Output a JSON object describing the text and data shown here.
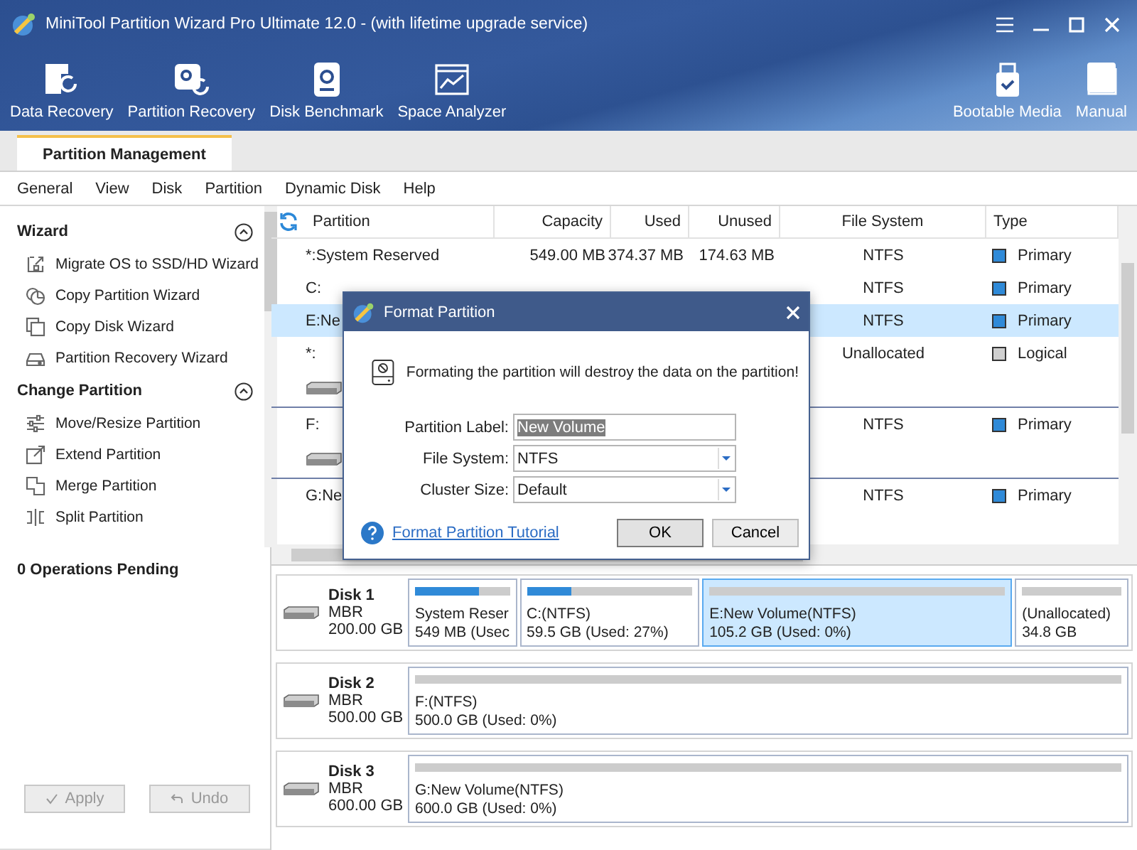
{
  "window": {
    "title": "MiniTool Partition Wizard Pro Ultimate 12.0 - (with lifetime upgrade service)"
  },
  "toolbar": {
    "left": [
      {
        "label": "Data Recovery",
        "kind": "data"
      },
      {
        "label": "Partition Recovery",
        "kind": "partition"
      },
      {
        "label": "Disk Benchmark",
        "kind": "benchmark"
      },
      {
        "label": "Space Analyzer",
        "kind": "analyzer"
      }
    ],
    "right": [
      {
        "label": "Bootable Media",
        "kind": "usb"
      },
      {
        "label": "Manual",
        "kind": "book"
      }
    ]
  },
  "tabs": [
    {
      "label": "Partition Management",
      "selected": true
    }
  ],
  "menu": [
    "General",
    "View",
    "Disk",
    "Partition",
    "Dynamic Disk",
    "Help"
  ],
  "sidebar": {
    "sections": [
      {
        "title": "Wizard",
        "expanded": true,
        "items": [
          {
            "label": "Migrate OS to SSD/HD Wizard",
            "kind": "migrate"
          },
          {
            "label": "Copy Partition Wizard",
            "kind": "copy-partition"
          },
          {
            "label": "Copy Disk Wizard",
            "kind": "copy-disk"
          },
          {
            "label": "Partition Recovery Wizard",
            "kind": "recovery"
          }
        ]
      },
      {
        "title": "Change Partition",
        "expanded": true,
        "items": [
          {
            "label": "Move/Resize Partition",
            "kind": "resize"
          },
          {
            "label": "Extend Partition",
            "kind": "extend"
          },
          {
            "label": "Merge Partition",
            "kind": "merge"
          },
          {
            "label": "Split Partition",
            "kind": "split"
          }
        ]
      }
    ],
    "pending": "0 Operations Pending",
    "buttons": [
      {
        "label": "Apply",
        "kind": "apply",
        "disabled": true
      },
      {
        "label": "Undo",
        "kind": "undo",
        "disabled": true
      }
    ]
  },
  "table": {
    "columns": [
      "Partition",
      "Capacity",
      "Used",
      "Unused",
      "File System",
      "Type"
    ],
    "rows": [
      {
        "kind": "partition",
        "selected": false,
        "partition": "*:System Reserved",
        "capacity": "549.00 MB",
        "used": "374.37 MB",
        "unused": "174.63 MB",
        "file_system": "NTFS",
        "type": "Primary",
        "color": "#2f8ad8"
      },
      {
        "kind": "partition",
        "selected": false,
        "partition": "C:",
        "file_system": "NTFS",
        "type": "Primary",
        "color": "#2f8ad8"
      },
      {
        "kind": "partition",
        "selected": true,
        "partition": "E:Ne",
        "file_system": "NTFS",
        "type": "Primary",
        "color": "#2f8ad8"
      },
      {
        "kind": "partition",
        "selected": false,
        "partition": "*:",
        "file_system": "Unallocated",
        "type": "Logical",
        "color": "#d0d0d0"
      },
      {
        "kind": "disk",
        "selected": false
      },
      {
        "kind": "partition",
        "selected": false,
        "partition": "F:",
        "file_system": "NTFS",
        "type": "Primary",
        "color": "#2f8ad8"
      },
      {
        "kind": "disk",
        "selected": false
      },
      {
        "kind": "partition",
        "selected": false,
        "partition": "G:Ne",
        "file_system": "NTFS",
        "type": "Primary",
        "color": "#2f8ad8"
      }
    ]
  },
  "disk_map": [
    {
      "name": "Disk 1",
      "scheme": "MBR",
      "size": "200.00 GB",
      "partitions": [
        {
          "label": "System Reser",
          "detail": "549 MB (Usec",
          "level": 0.68,
          "selected": false
        },
        {
          "label": "C:(NTFS)",
          "detail": "59.5 GB (Used: 27%)",
          "level": 0.27,
          "selected": false
        },
        {
          "label": "E:New Volume(NTFS)",
          "detail": "105.2 GB (Used: 0%)",
          "selected": true
        },
        {
          "label": "(Unallocated)",
          "detail": "34.8 GB",
          "selected": false
        }
      ]
    },
    {
      "name": "Disk 2",
      "scheme": "MBR",
      "size": "500.00 GB",
      "partitions": [
        {
          "label": "F:(NTFS)",
          "detail": "500.0 GB (Used: 0%)",
          "selected": false
        }
      ]
    },
    {
      "name": "Disk 3",
      "scheme": "MBR",
      "size": "600.00 GB",
      "partitions": [
        {
          "label": "G:New Volume(NTFS)",
          "detail": "600.0 GB (Used: 0%)",
          "selected": false
        }
      ]
    }
  ],
  "dialog": {
    "title": "Format Partition",
    "warning": "Formating the partition will destroy the data on the partition!",
    "fields": [
      {
        "label": "Partition Label:",
        "kind": "text",
        "value": "New Volume",
        "text_selected": true
      },
      {
        "label": "File System:",
        "kind": "select",
        "value": "NTFS"
      },
      {
        "label": "Cluster Size:",
        "kind": "select",
        "value": "Default"
      }
    ],
    "help_link": "Format Partition Tutorial",
    "buttons": [
      {
        "label": "OK",
        "default": true
      },
      {
        "label": "Cancel",
        "default": false
      }
    ]
  }
}
